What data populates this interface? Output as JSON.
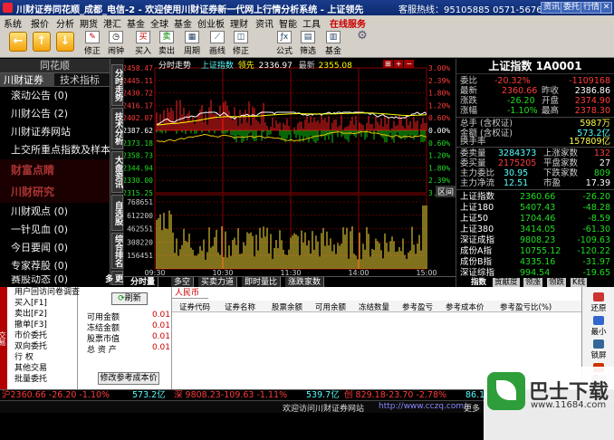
{
  "titlebar": {
    "title": "川财证券同花顺_成都_电信-2 - 欢迎使用川财证券新一代网上行情分析系统 - 上证领先",
    "hotline": "客服热线：95105885 0571-56768888",
    "btn_message": "资讯",
    "btn_contract": "委托",
    "btn_trade": "行情"
  },
  "menu": [
    "系统",
    "报价",
    "分析",
    "期货",
    "港汇",
    "基金",
    "全球",
    "基金",
    "创业板",
    "理财",
    "资讯",
    "智能",
    "工具"
  ],
  "menu_online": "在线服务",
  "toolbar": {
    "tools": [
      {
        "label": "修正",
        "icon": "pencil-icon"
      },
      {
        "label": "闹钟",
        "icon": "alarm-clock-icon"
      },
      {
        "label": "买入",
        "icon": "buy-icon"
      },
      {
        "label": "卖出",
        "icon": "sell-icon"
      },
      {
        "label": "周期",
        "icon": "period-icon"
      },
      {
        "label": "画线",
        "icon": "draw-line-icon"
      },
      {
        "label": "修正",
        "icon": "fix-icon"
      },
      {
        "label": "公式",
        "icon": "formula-icon"
      },
      {
        "label": "筛选",
        "icon": "filter-icon"
      },
      {
        "label": "基金",
        "icon": "fund-icon"
      }
    ]
  },
  "left_panel": {
    "header": "同花顺",
    "tab_active": "川财证券",
    "tab_other": "技术指标",
    "items": [
      "滚动公告 (0)",
      "川财公告 (2)",
      "川财证券网站",
      "上交所重点指数及样本"
    ],
    "section1": "财富点睛",
    "section2": "川财研究",
    "items2": [
      "川财观点 (0)",
      "一针见血 (0)",
      "今日要闻 (0)",
      "专家荐股 (0)",
      "赛股动态 (0)"
    ]
  },
  "vtabs": [
    "分时走势",
    "技术分析",
    "大盘资讯",
    "自选股",
    "综合排名",
    "更多"
  ],
  "chart": {
    "header_label": "分时走势",
    "header_index": "上证指数",
    "header_lead": "领先",
    "header_value1": "2336.97",
    "header_value2_label": "最新",
    "header_value2": "2355.08",
    "price_ticks": [
      "2458.47",
      "2445.11",
      "2430.72",
      "2416.17",
      "2402.07",
      "2387.62",
      "2373.18",
      "2358.73",
      "2344.94",
      "2330.00",
      "2315.25"
    ],
    "pct_ticks": [
      "3.00%",
      "2.39%",
      "1.80%",
      "1.20%",
      "0.60%",
      "0.00%",
      "0.60%",
      "1.20%",
      "1.80%",
      "2.39%",
      "3.00%"
    ],
    "vol_ticks": [
      "768651",
      "612200",
      "462551",
      "308220",
      "156451"
    ],
    "time_ticks": [
      "09:30",
      "10:30",
      "11:30",
      "14:00",
      "15:00"
    ],
    "section": "区间"
  },
  "chart_tabs": [
    "分时量",
    "多空",
    "买卖力道",
    "即时量比",
    "涨跌家数"
  ],
  "quote": {
    "title": "上证指数 1A0001",
    "rows": [
      {
        "l": "委比",
        "v1": "-20.32%",
        "v1c": "red",
        "v2": "-1109168",
        "v2c": "red"
      },
      {
        "l": "最新",
        "v1": "2360.66",
        "v1c": "red",
        "l2": "昨收",
        "v2": "2386.86",
        "v2c": "wht"
      },
      {
        "l": "涨跌",
        "v1": "-26.20",
        "v1c": "grn",
        "l2": "开盘",
        "v2": "2374.90",
        "v2c": "red"
      },
      {
        "l": "涨幅",
        "v1": "-1.10%",
        "v1c": "grn",
        "l2": "最高",
        "v2": "2378.30",
        "v2c": "red"
      }
    ],
    "hands_label": "总手 (含权证)",
    "hands_value": "5987万",
    "amount_label": "金额 (含权证)",
    "amount_value": "573.2亿",
    "turnover_label": "换手率",
    "turnover_value": "157809亿",
    "buy_label": "委卖量",
    "buy_value": "3284373",
    "up_label": "上涨家数",
    "up_value": "132",
    "sell_label": "委买量",
    "sell_value": "2175205",
    "flat_label": "平盘家数",
    "flat_value": "27",
    "adv_label": "主力委比",
    "adv_value": "30.95",
    "down_label": "下跌家数",
    "down_value": "809",
    "pe_label": "主力净流",
    "pe_value": "12.51",
    "mv_label": "市盈",
    "mv_value": "17.39",
    "indices": [
      {
        "name": "上证指数",
        "price": "2360.66",
        "chg": "-26.20"
      },
      {
        "name": "上证180",
        "price": "5407.43",
        "chg": "-48.28"
      },
      {
        "name": "上证50",
        "price": "1704.46",
        "chg": "-8.59"
      },
      {
        "name": "上证380",
        "price": "3414.05",
        "chg": "-61.30"
      },
      {
        "name": "深证成指",
        "price": "9808.23",
        "chg": "-109.63"
      },
      {
        "name": "成份A指",
        "price": "10755.12",
        "chg": "-120.22"
      },
      {
        "name": "成份B指",
        "price": "4335.16",
        "chg": "-31.97"
      },
      {
        "name": "深证综指",
        "price": "994.54",
        "chg": "-19.65"
      }
    ],
    "tabs": [
      "指数",
      "贡献度",
      "领涨",
      "领跌",
      "K线"
    ]
  },
  "trade": {
    "side_label": "交易",
    "menu": [
      "用户回访问卷调查",
      "买入[F1]",
      "卖出[F2]",
      "撤单[F3]",
      "市价委托",
      "双向委托",
      "行  权",
      "其他交易",
      "批量委托"
    ],
    "refresh": "刷新",
    "summary": [
      {
        "l": "可用金额",
        "v": "0.01"
      },
      {
        "l": "冻结金额",
        "v": "0.01"
      },
      {
        "l": "股票市值",
        "v": "0.01"
      },
      {
        "l": "总 资 产",
        "v": "0.01"
      }
    ],
    "cost_btn": "修改参考成本价",
    "currency": "人民币",
    "columns": [
      "证券代码",
      "证券名称",
      "股票余额",
      "可用余额",
      "冻结数量",
      "参考盈亏",
      "参考成本价",
      "参考盈亏比(%)"
    ],
    "right_buttons": [
      "还原",
      "最小",
      "锁屏",
      "退出"
    ]
  },
  "statusbar": {
    "sh": "沪2360.66 -26.20 -1.10%",
    "sh_amount": "573.2亿",
    "sz": "深 9808.23-109.63 -1.11%",
    "sz_amount": "539.7亿",
    "cy": "创  829.18-23.70 -2.78%",
    "cy_amount": "86.18亿",
    "extra": "中小"
  },
  "footer": {
    "welcome": "欢迎访问川财证券网站",
    "url": "http://www.cczq.com/",
    "more": "更多"
  },
  "watermark": {
    "brand": "巴士下载",
    "url": "www.11684.com"
  },
  "colors": {
    "up": "#ff3b3b",
    "down": "#22dd22",
    "accent": "#ffff44",
    "title_bg": "#1a3c8a"
  }
}
